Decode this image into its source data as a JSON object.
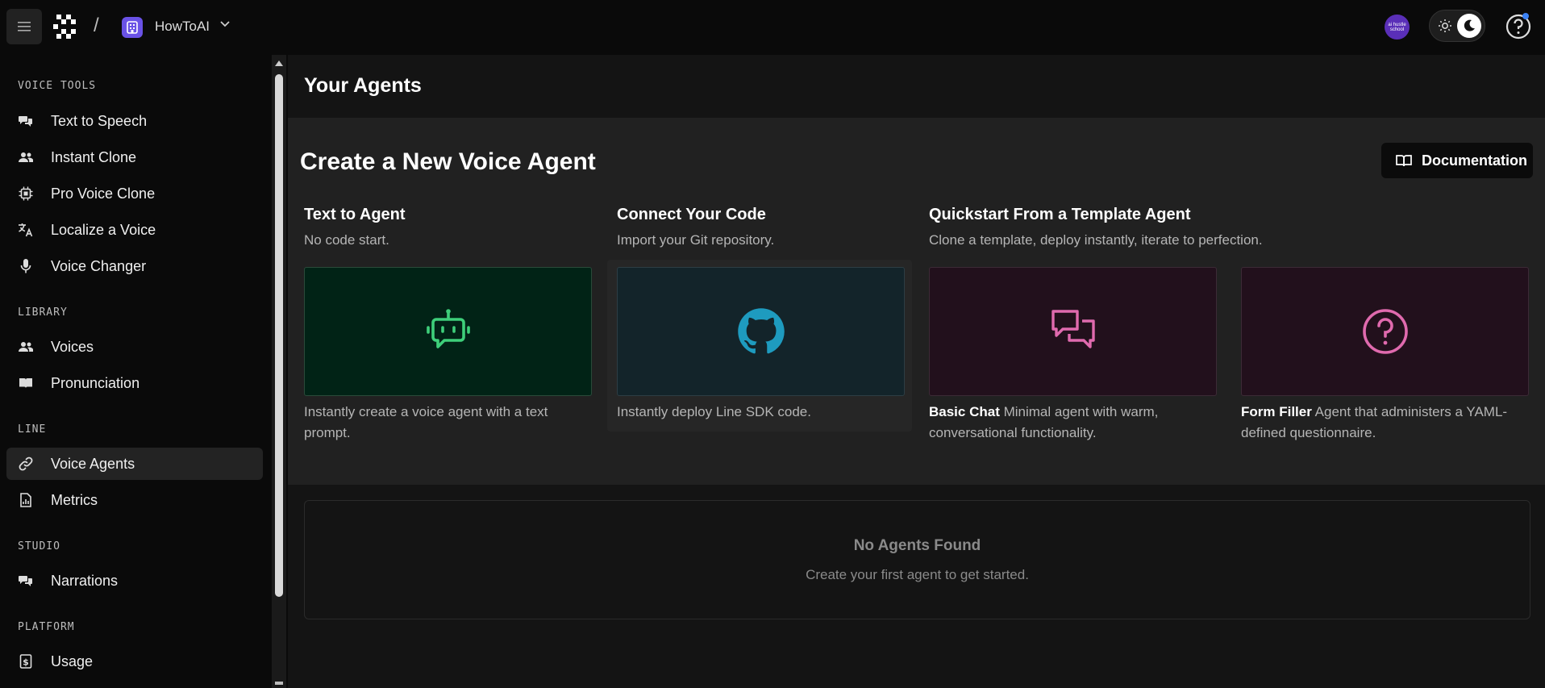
{
  "header": {
    "separator": "/",
    "workspace_name": "HowToAI",
    "avatar_text": "ai hustle school"
  },
  "sidebar": {
    "sections": [
      {
        "label": "VOICE TOOLS"
      },
      {
        "label": "LIBRARY"
      },
      {
        "label": "LINE"
      },
      {
        "label": "STUDIO"
      },
      {
        "label": "PLATFORM"
      }
    ],
    "items": [
      {
        "label": "Text to Speech",
        "icon": "speech-bubbles-icon"
      },
      {
        "label": "Instant Clone",
        "icon": "users-icon"
      },
      {
        "label": "Pro Voice Clone",
        "icon": "chip-icon"
      },
      {
        "label": "Localize a Voice",
        "icon": "translate-icon"
      },
      {
        "label": "Voice Changer",
        "icon": "microphone-icon"
      },
      {
        "label": "Voices",
        "icon": "users-icon"
      },
      {
        "label": "Pronunciation",
        "icon": "book-icon"
      },
      {
        "label": "Voice Agents",
        "icon": "link-icon",
        "active": true
      },
      {
        "label": "Metrics",
        "icon": "chart-file-icon"
      },
      {
        "label": "Narrations",
        "icon": "speech-bubbles-icon"
      },
      {
        "label": "Usage",
        "icon": "dollar-file-icon"
      }
    ]
  },
  "main": {
    "page_title": "Your Agents",
    "create_title": "Create a New Voice Agent",
    "documentation_label": "Documentation",
    "columns": [
      {
        "title": "Text to Agent",
        "subtitle": "No code start."
      },
      {
        "title": "Connect Your Code",
        "subtitle": "Import your Git repository."
      },
      {
        "title": "Quickstart From a Template Agent",
        "subtitle": "Clone a template, deploy instantly, iterate to perfection."
      }
    ],
    "cards": [
      {
        "desc": "Instantly create a voice agent with a text prompt.",
        "icon": "robot-icon"
      },
      {
        "desc": "Instantly deploy Line SDK code.",
        "icon": "github-icon"
      },
      {
        "bold": "Basic Chat",
        "desc": " Minimal agent with warm, conversational functionality.",
        "icon": "chat-icon"
      },
      {
        "bold": "Form Filler",
        "desc": " Agent that administers a YAML-defined questionnaire.",
        "icon": "question-icon"
      }
    ],
    "empty_title": "No Agents Found",
    "empty_subtitle": "Create your first agent to get started."
  },
  "colors": {
    "accent_green": "#3ecf7a",
    "accent_teal": "#1e9bbf",
    "accent_pink": "#e06aae",
    "workspace_purple": "#6a52e6"
  }
}
